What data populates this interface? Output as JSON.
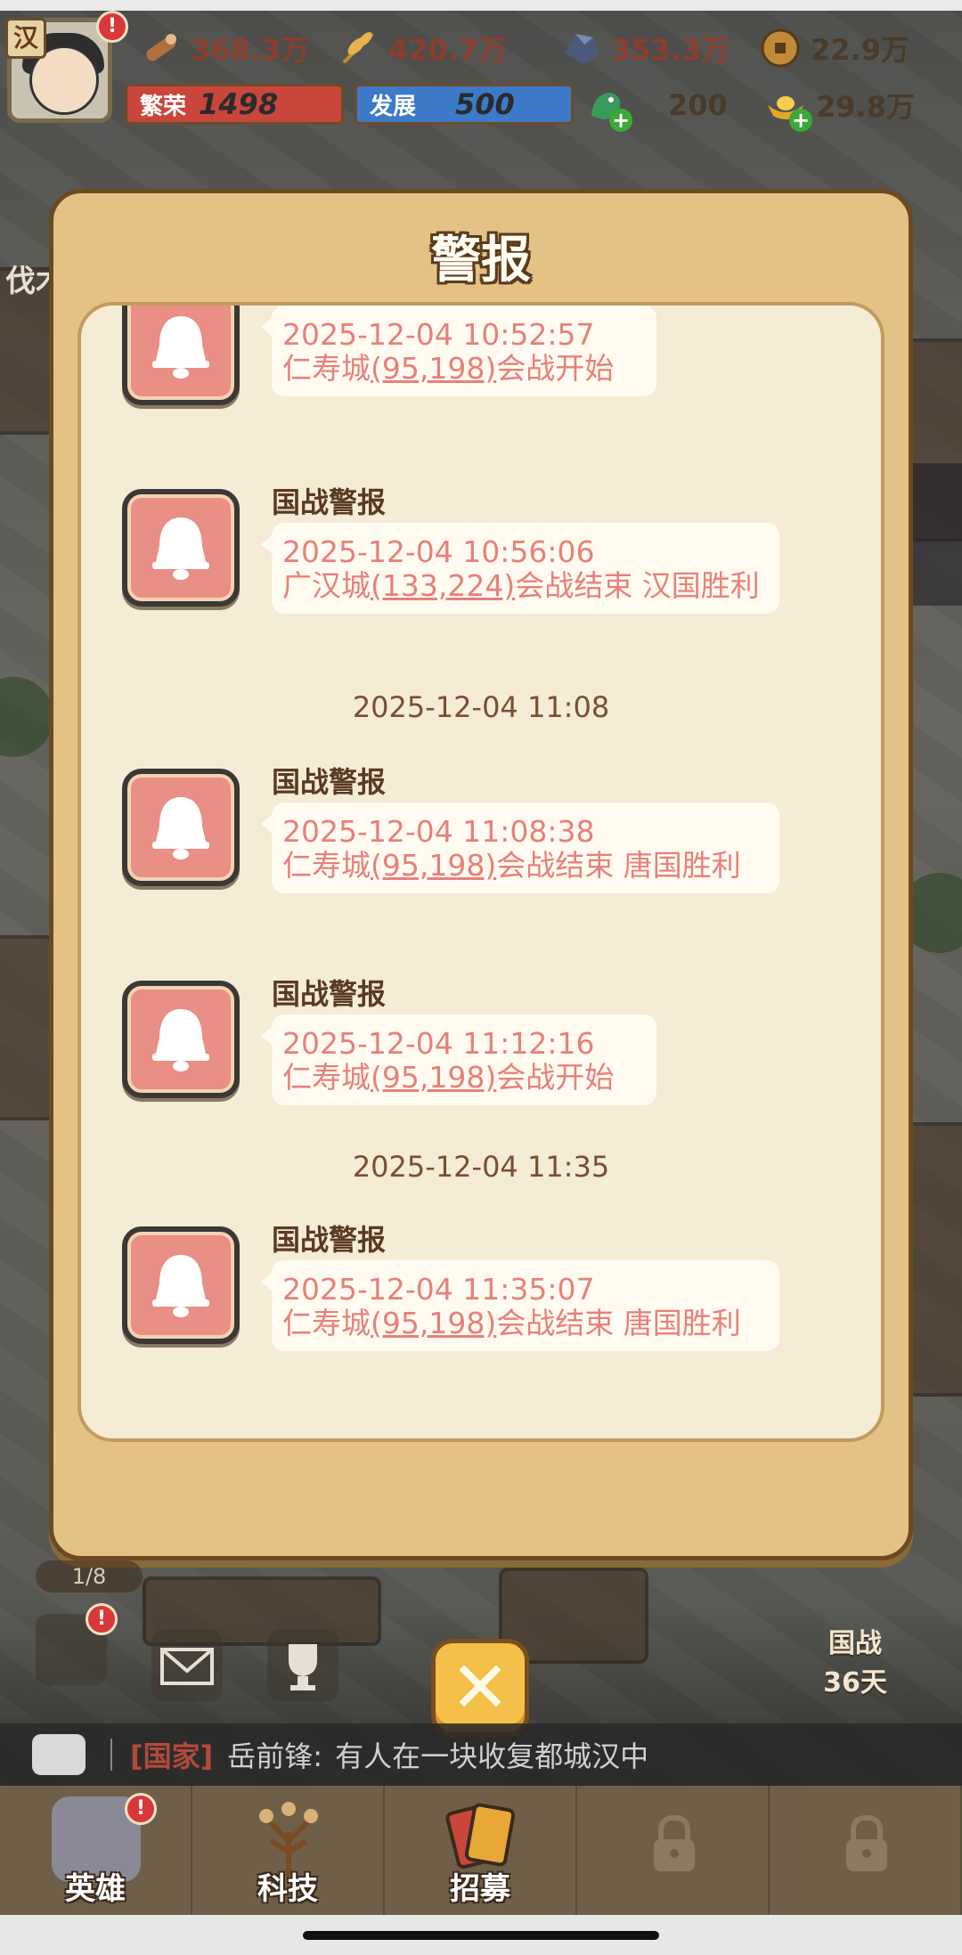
{
  "hud": {
    "nation": "汉",
    "resources": [
      {
        "icon": "wood-icon",
        "value": "368.3万"
      },
      {
        "icon": "grain-icon",
        "value": "420.7万"
      },
      {
        "icon": "iron-ore-icon",
        "value": "353.3万"
      },
      {
        "icon": "copper-coin-icon",
        "value": "22.9万"
      }
    ],
    "prosperity": {
      "label": "繁荣",
      "value": "1498"
    },
    "development": {
      "label": "发展",
      "value": "500"
    },
    "jade": {
      "icon": "jade-dragon-icon",
      "value": "200"
    },
    "gold": {
      "icon": "gold-ingot-icon",
      "value": "29.8万"
    }
  },
  "modal": {
    "title": "警报",
    "messages": [
      {
        "sender": "",
        "timestamp": "2025-12-04 10:52:57",
        "city": "仁寿城",
        "coord": "(95,198)",
        "text_after": "会战开始"
      },
      {
        "sender": "国战警报",
        "timestamp": "2025-12-04 10:56:06",
        "city": "广汉城",
        "coord": "(133,224)",
        "text_after": "会战结束 汉国胜利"
      },
      {
        "sender": "国战警报",
        "timestamp": "2025-12-04 11:08:38",
        "city": "仁寿城",
        "coord": "(95,198)",
        "text_after": "会战结束 唐国胜利"
      },
      {
        "sender": "国战警报",
        "timestamp": "2025-12-04 11:12:16",
        "city": "仁寿城",
        "coord": "(95,198)",
        "text_after": "会战开始"
      },
      {
        "sender": "国战警报",
        "timestamp": "2025-12-04 11:35:07",
        "city": "仁寿城",
        "coord": "(95,198)",
        "text_after": "会战结束 唐国胜利"
      }
    ],
    "separators": [
      "2025-12-04 11:08",
      "2025-12-04 11:35"
    ]
  },
  "side": {
    "left_label": "伐木",
    "progress": "1/8",
    "war_label": "国战",
    "war_days": "36天"
  },
  "chat": {
    "channel": "[国家]",
    "sender": "岳前锋:",
    "message": "有人在一块收复都城汉中"
  },
  "nav": [
    {
      "label": "英雄",
      "icon": "hero-icon"
    },
    {
      "label": "科技",
      "icon": "tech-tree-icon"
    },
    {
      "label": "招募",
      "icon": "recruit-cards-icon"
    },
    {
      "label": "",
      "icon": "lock-icon"
    },
    {
      "label": "",
      "icon": "lock-icon"
    }
  ],
  "colors": {
    "alert_text": "#e8807a",
    "modal_bg": "#e4c185",
    "panel_bg": "#f5ecd6",
    "bell_bg": "#e98f86",
    "close_button": "#f4c04a"
  }
}
